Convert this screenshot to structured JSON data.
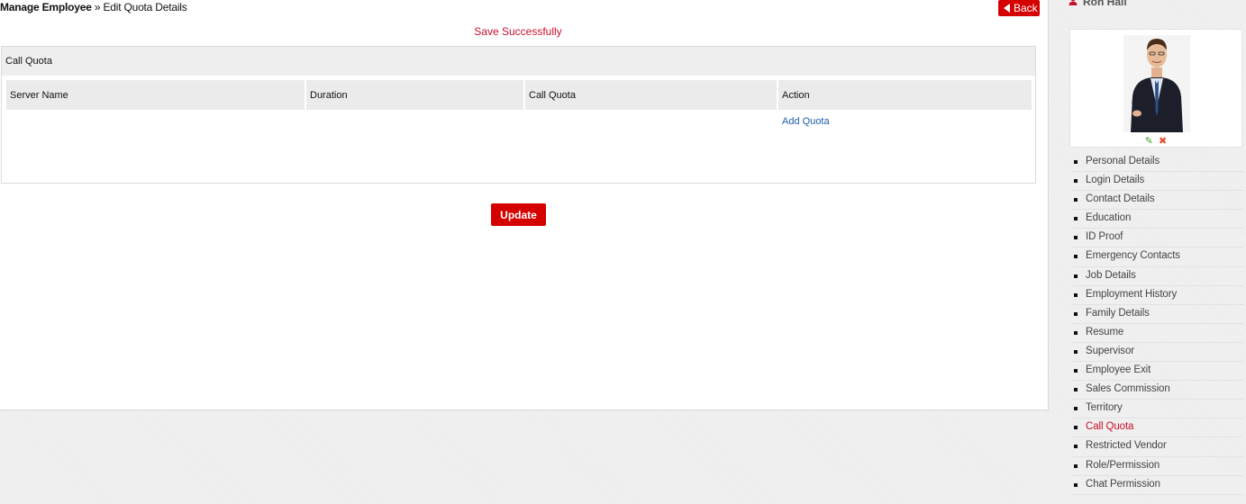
{
  "breadcrumb": {
    "parent": "Manage Employee",
    "separator": " » ",
    "current": "Edit Quota Details"
  },
  "back_button": {
    "label": "Back"
  },
  "status_message": "Save Successfully",
  "panel": {
    "title": "Call Quota",
    "columns": [
      "Server Name",
      "Duration",
      "Call Quota",
      "Action"
    ],
    "add_link": "Add Quota"
  },
  "update_button": {
    "label": "Update"
  },
  "user": {
    "name": "Ron Hall"
  },
  "icons": {
    "back": "left-triangle-icon",
    "user": "user-icon",
    "edit": "pencil-icon",
    "remove": "close-icon"
  },
  "colors": {
    "accent_red": "#d50000",
    "status_red": "#c8102e",
    "link_blue": "#1f5ea8"
  },
  "side_menu": {
    "active_index": 14,
    "items": [
      "Personal Details",
      "Login Details",
      "Contact Details",
      "Education",
      "ID Proof",
      "Emergency Contacts",
      "Job Details",
      "Employment History",
      "Family Details",
      "Resume",
      "Supervisor",
      "Employee Exit",
      "Sales Commission",
      "Territory",
      "Call Quota",
      "Restricted Vendor",
      "Role/Permission",
      "Chat Permission"
    ]
  }
}
